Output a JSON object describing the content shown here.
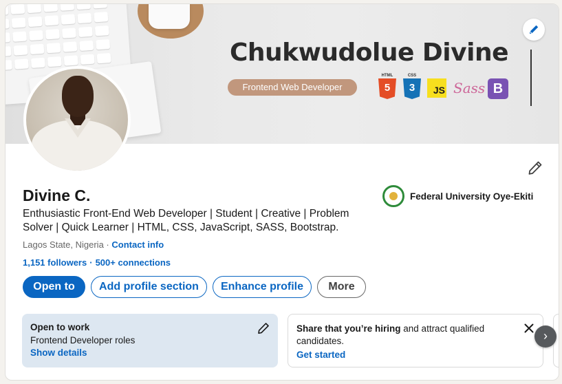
{
  "banner": {
    "name": "Chukwudolue Divine",
    "role": "Frontend Web Developer",
    "tech": {
      "html_caption": "HTML",
      "html_symbol": "5",
      "css_caption": "CSS",
      "css_symbol": "3",
      "js": "JS",
      "sass": "Sass",
      "bootstrap": "B"
    },
    "edit_icon": "pencil-icon"
  },
  "profile": {
    "name": "Divine C.",
    "headline": "Enthusiastic Front-End Web Developer | Student | Creative | Problem Solver | Quick Learner | HTML, CSS, JavaScript, SASS, Bootstrap.",
    "location": "Lagos State, Nigeria",
    "location_sep": " · ",
    "contact_info": "Contact info",
    "followers": "1,151 followers",
    "network_sep": "·",
    "connections": "500+ connections",
    "education": "Federal University Oye-Ekiti"
  },
  "actions": {
    "open_to": "Open to",
    "add_section": "Add profile section",
    "enhance": "Enhance profile",
    "more": "More"
  },
  "open_to_work": {
    "title": "Open to work",
    "roles": "Frontend Developer roles",
    "link": "Show details"
  },
  "hiring": {
    "bold": "Share that you’re hiring",
    "rest": " and attract qualified candidates.",
    "link": "Get started"
  },
  "carousel": {
    "next_icon": "›"
  },
  "colors": {
    "accent": "#0a66c2",
    "open_to_work_bg": "#dde7f1",
    "banner_role_pill": "#c1977d",
    "page_bg": "#f4f2ee"
  }
}
